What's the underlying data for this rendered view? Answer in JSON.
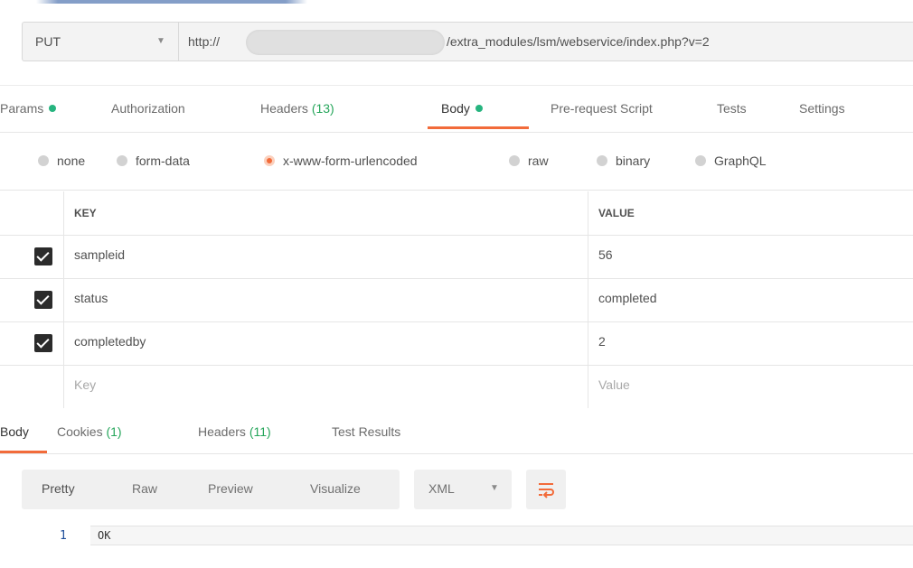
{
  "request": {
    "method": "PUT",
    "url_prefix": "http://",
    "url_suffix": "/extra_modules/lsm/webservice/index.php?v=2"
  },
  "request_tabs": [
    {
      "label": "Params",
      "indicator_dot": true
    },
    {
      "label": "Authorization"
    },
    {
      "label": "Headers",
      "count": "(13)"
    },
    {
      "label": "Body",
      "indicator_dot": true,
      "active": true
    },
    {
      "label": "Pre-request Script"
    },
    {
      "label": "Tests"
    },
    {
      "label": "Settings"
    }
  ],
  "body_types": [
    {
      "label": "none"
    },
    {
      "label": "form-data"
    },
    {
      "label": "x-www-form-urlencoded",
      "selected": true
    },
    {
      "label": "raw"
    },
    {
      "label": "binary"
    },
    {
      "label": "GraphQL"
    }
  ],
  "kv_table": {
    "key_header": "KEY",
    "value_header": "VALUE",
    "rows": [
      {
        "key": "sampleid",
        "value": "56",
        "checked": true
      },
      {
        "key": "status",
        "value": "completed",
        "checked": true
      },
      {
        "key": "completedby",
        "value": "2",
        "checked": true
      }
    ],
    "placeholder_key": "Key",
    "placeholder_value": "Value"
  },
  "response_tabs": [
    {
      "label": "Body",
      "active": true
    },
    {
      "label": "Cookies",
      "count": "(1)"
    },
    {
      "label": "Headers",
      "count": "(11)"
    },
    {
      "label": "Test Results"
    }
  ],
  "response_toolbar": {
    "formats": [
      "Pretty",
      "Raw",
      "Preview",
      "Visualize"
    ],
    "language": "XML",
    "wrap_icon": "text-wrap-icon"
  },
  "response_output": {
    "line_number": "1",
    "text": "OK"
  },
  "colors": {
    "accent": "#f26b3a",
    "indicator": "#26b47f",
    "count_green": "#26a65b",
    "line_number": "#1f4f9a"
  }
}
